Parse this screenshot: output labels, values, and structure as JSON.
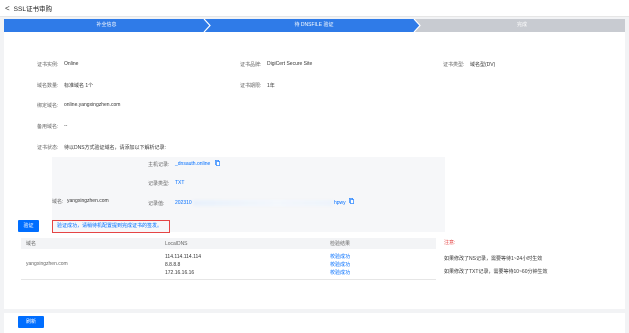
{
  "header": {
    "back_label": "<",
    "title": "SSL证书审购"
  },
  "steps": [
    {
      "label": "补全信息",
      "state": "done"
    },
    {
      "label": "待 DNSFILE 验证",
      "state": "active"
    },
    {
      "label": "完成",
      "state": "pending"
    }
  ],
  "cert": {
    "id_label": "证书实例:",
    "id_value": "Online",
    "brand_label": "证书品牌:",
    "brand_value": "DigiCert Secure Site",
    "type_label": "证书类型:",
    "type_value": "域名型(DV)",
    "count_label": "域名数量:",
    "count_value": "标准域名 1个",
    "period_label": "证书期限:",
    "period_value": "1年",
    "bind_label": "绑定域名:",
    "bind_value": "online.yangxingzhen.com",
    "backup_label": "备用域名:",
    "backup_value": "--",
    "status_label": "证书状态:",
    "status_value": "待以DNS方式验证域名，请添加以下解析记录:"
  },
  "dns": {
    "domain_label": "域名:",
    "domain_value": "yangxingzhen.com",
    "host_label": "主机记录:",
    "host_value": "_dnsauth.online",
    "rtype_label": "记录类型:",
    "rtype_value": "TXT",
    "rvalue_label": "记录值:",
    "rvalue_prefix": "202310",
    "rvalue_suffix": "hpwy"
  },
  "verify": {
    "button": "验证",
    "message": "验证成功，请稍待机配置提到完成证书的签发。"
  },
  "results": {
    "columns": [
      "域名",
      "LocalDNS",
      "检验结果"
    ],
    "domain": "yangxingzhen.com",
    "dns": [
      "114.114.114.114",
      "8.8.8.8",
      "172.16.16.16"
    ],
    "status": [
      "校验成功",
      "校验成功",
      "校验成功"
    ]
  },
  "notes": {
    "title": "注意:",
    "line1": "如果修改了NS记录，需要等待1~24小时生效",
    "line2": "如果修改了TXT记录，需要等待10~60分钟生效"
  },
  "footer": {
    "button": "刷新"
  },
  "colors": {
    "primary": "#006eff",
    "step_done": "#2f7be8",
    "step_pending": "#c8cbd1",
    "error": "#e54545"
  }
}
